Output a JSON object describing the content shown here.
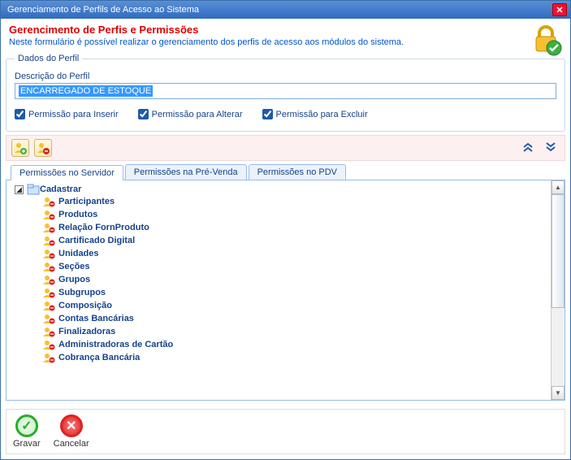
{
  "window": {
    "title": "Gerenciamento de Perfils de Acesso ao Sistema"
  },
  "header": {
    "title": "Gerencimento de Perfis e Permissões",
    "subtitle": "Neste formulário é possível realizar o gerenciamento dos perfis de acesso aos módulos do sistema."
  },
  "fieldset": {
    "legend": "Dados do Perfil",
    "desc_label": "Descrição do Perfil",
    "desc_value": "ENCARREGADO DE ESTOQUE"
  },
  "checks": {
    "insert": "Permissão para Inserir",
    "update": "Permissão para Alterar",
    "delete": "Permissão para Excluir"
  },
  "tabs": {
    "servidor": "Permissões no Servidor",
    "prevenda": "Permissões na Pré-Venda",
    "pdv": "Permissões no PDV"
  },
  "tree": {
    "root": "Cadastrar",
    "items": [
      "Participantes",
      "Produtos",
      "Relação FornProduto",
      "Cartificado Digital",
      "Unidades",
      "Seções",
      "Grupos",
      "Subgrupos",
      "Composição",
      "Contas Bancárias",
      "Finalizadoras",
      "Administradoras de Cartão",
      "Cobrança Bancária"
    ]
  },
  "footer": {
    "save": "Gravar",
    "cancel": "Cancelar"
  }
}
